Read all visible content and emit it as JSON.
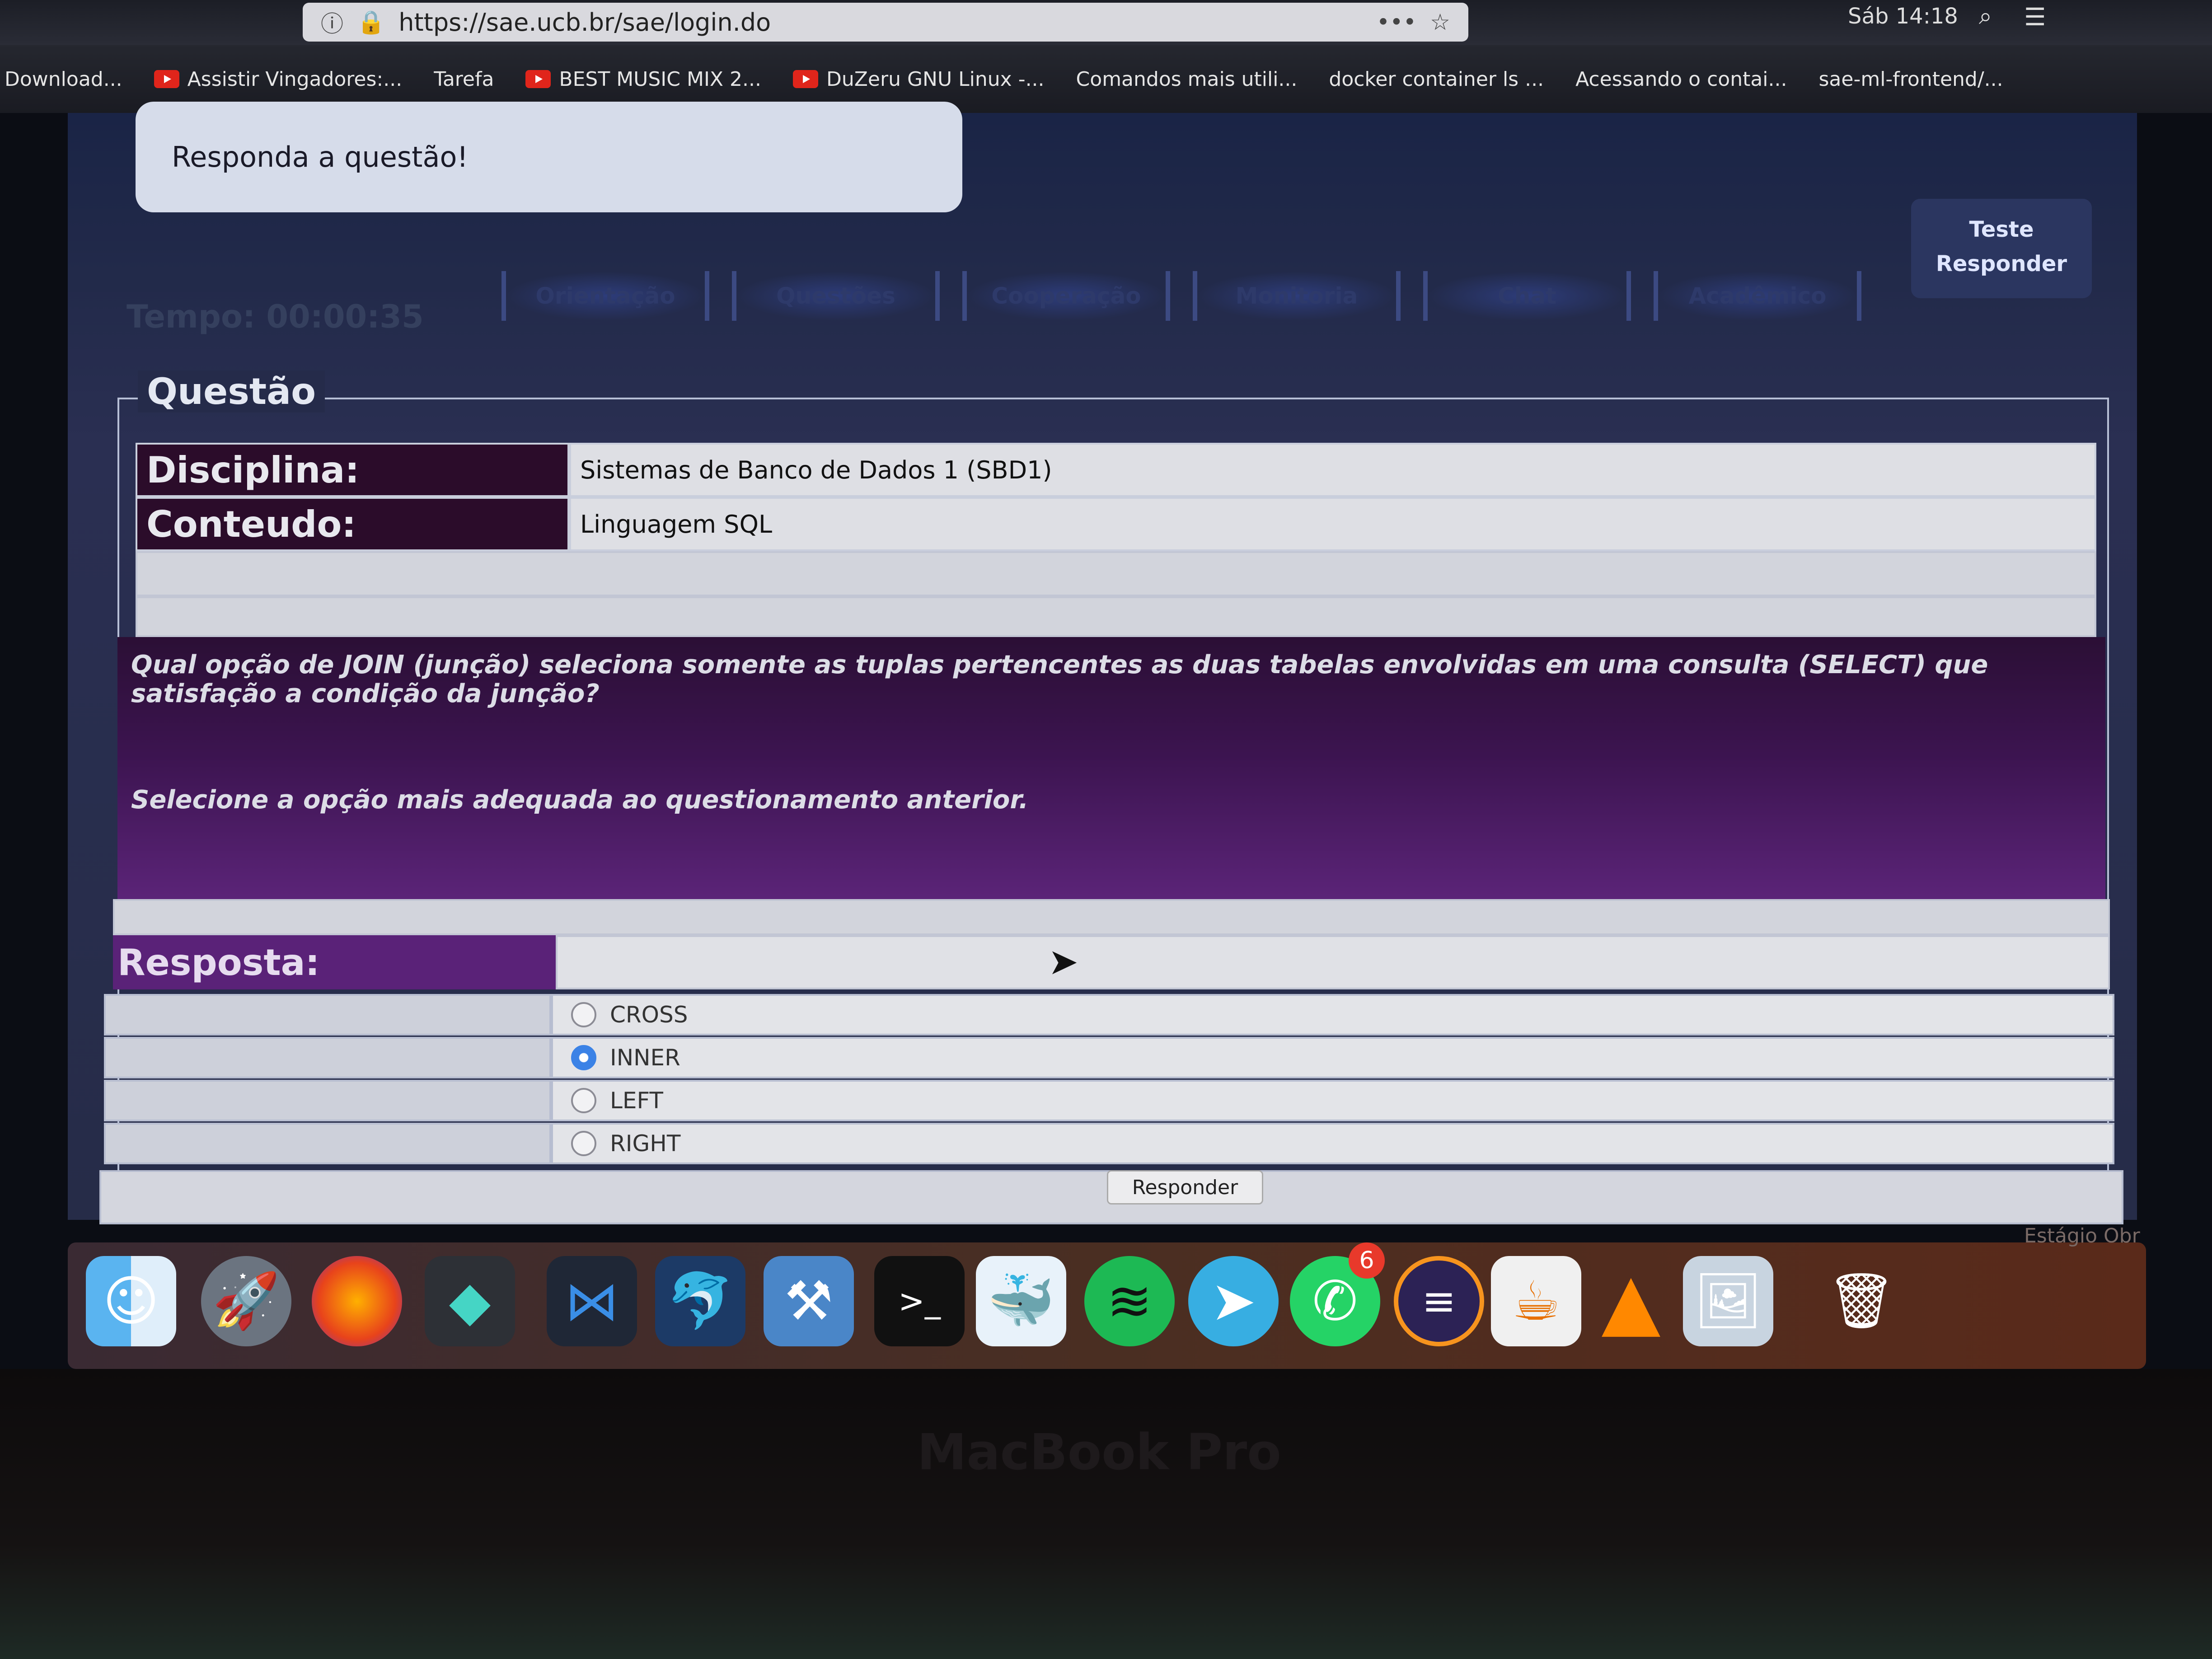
{
  "browser": {
    "url": "https://sae.ucb.br/sae/login.do",
    "clock": "Sáb 14:18",
    "bookmarks": [
      "Download...",
      "Assistir Vingadores:...",
      "Tarefa",
      "BEST MUSIC MIX 2...",
      "DuZeru GNU Linux -...",
      "Comandos mais utili...",
      "docker container ls ...",
      "Acessando o contai...",
      "sae-ml-frontend/..."
    ]
  },
  "header": {
    "prompt": "Responda a questão!",
    "actions": [
      "Teste",
      "Responder"
    ],
    "timer": "Tempo: 00:00:35",
    "tabs": [
      "Orientação",
      "Questões",
      "Cooperação",
      "Monitoria",
      "Chat",
      "Acadêmico"
    ]
  },
  "question": {
    "legend": "Questão",
    "disciplina_label": "Disciplina:",
    "disciplina_value": "Sistemas de Banco de Dados 1 (SBD1)",
    "conteudo_label": "Conteudo:",
    "conteudo_value": "Linguagem SQL",
    "text": "Qual opção de JOIN (junção) seleciona somente as tuplas pertencentes as duas tabelas envolvidas em uma consulta (SELECT) que satisfação a condição da junção?",
    "instruction": "Selecione a opção mais adequada ao questionamento anterior."
  },
  "answer": {
    "label": "Resposta:",
    "options": [
      {
        "label": "CROSS",
        "selected": false
      },
      {
        "label": "INNER",
        "selected": true
      },
      {
        "label": "LEFT",
        "selected": false
      },
      {
        "label": "RIGHT",
        "selected": false
      }
    ],
    "submit": "Responder"
  },
  "dock": {
    "apps": [
      "finder-icon",
      "launchpad-icon",
      "firefox-icon",
      "sublime-icon",
      "vscode-icon",
      "mysql-workbench-icon",
      "xcode-icon",
      "terminal-icon",
      "docker-icon",
      "spotify-icon",
      "telegram-icon",
      "whatsapp-icon",
      "eclipse-icon",
      "java-icon",
      "vlc-icon",
      "preview-icon",
      "trash-icon"
    ],
    "whatsapp_badge": "6",
    "watermark": "Estágio Obr"
  },
  "device": "MacBook Pro"
}
